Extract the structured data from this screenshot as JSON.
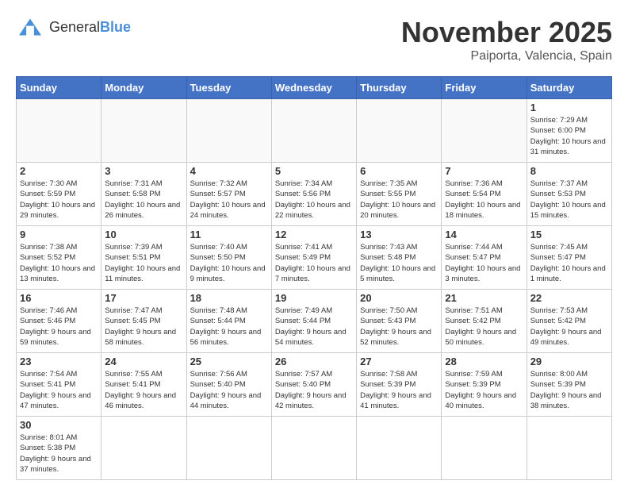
{
  "logo": {
    "text_general": "General",
    "text_blue": "Blue"
  },
  "calendar": {
    "title": "November 2025",
    "subtitle": "Paiporta, Valencia, Spain",
    "days_of_week": [
      "Sunday",
      "Monday",
      "Tuesday",
      "Wednesday",
      "Thursday",
      "Friday",
      "Saturday"
    ],
    "weeks": [
      [
        {
          "day": "",
          "info": ""
        },
        {
          "day": "",
          "info": ""
        },
        {
          "day": "",
          "info": ""
        },
        {
          "day": "",
          "info": ""
        },
        {
          "day": "",
          "info": ""
        },
        {
          "day": "",
          "info": ""
        },
        {
          "day": "1",
          "info": "Sunrise: 7:29 AM\nSunset: 6:00 PM\nDaylight: 10 hours and 31 minutes."
        }
      ],
      [
        {
          "day": "2",
          "info": "Sunrise: 7:30 AM\nSunset: 5:59 PM\nDaylight: 10 hours and 29 minutes."
        },
        {
          "day": "3",
          "info": "Sunrise: 7:31 AM\nSunset: 5:58 PM\nDaylight: 10 hours and 26 minutes."
        },
        {
          "day": "4",
          "info": "Sunrise: 7:32 AM\nSunset: 5:57 PM\nDaylight: 10 hours and 24 minutes."
        },
        {
          "day": "5",
          "info": "Sunrise: 7:34 AM\nSunset: 5:56 PM\nDaylight: 10 hours and 22 minutes."
        },
        {
          "day": "6",
          "info": "Sunrise: 7:35 AM\nSunset: 5:55 PM\nDaylight: 10 hours and 20 minutes."
        },
        {
          "day": "7",
          "info": "Sunrise: 7:36 AM\nSunset: 5:54 PM\nDaylight: 10 hours and 18 minutes."
        },
        {
          "day": "8",
          "info": "Sunrise: 7:37 AM\nSunset: 5:53 PM\nDaylight: 10 hours and 15 minutes."
        }
      ],
      [
        {
          "day": "9",
          "info": "Sunrise: 7:38 AM\nSunset: 5:52 PM\nDaylight: 10 hours and 13 minutes."
        },
        {
          "day": "10",
          "info": "Sunrise: 7:39 AM\nSunset: 5:51 PM\nDaylight: 10 hours and 11 minutes."
        },
        {
          "day": "11",
          "info": "Sunrise: 7:40 AM\nSunset: 5:50 PM\nDaylight: 10 hours and 9 minutes."
        },
        {
          "day": "12",
          "info": "Sunrise: 7:41 AM\nSunset: 5:49 PM\nDaylight: 10 hours and 7 minutes."
        },
        {
          "day": "13",
          "info": "Sunrise: 7:43 AM\nSunset: 5:48 PM\nDaylight: 10 hours and 5 minutes."
        },
        {
          "day": "14",
          "info": "Sunrise: 7:44 AM\nSunset: 5:47 PM\nDaylight: 10 hours and 3 minutes."
        },
        {
          "day": "15",
          "info": "Sunrise: 7:45 AM\nSunset: 5:47 PM\nDaylight: 10 hours and 1 minute."
        }
      ],
      [
        {
          "day": "16",
          "info": "Sunrise: 7:46 AM\nSunset: 5:46 PM\nDaylight: 9 hours and 59 minutes."
        },
        {
          "day": "17",
          "info": "Sunrise: 7:47 AM\nSunset: 5:45 PM\nDaylight: 9 hours and 58 minutes."
        },
        {
          "day": "18",
          "info": "Sunrise: 7:48 AM\nSunset: 5:44 PM\nDaylight: 9 hours and 56 minutes."
        },
        {
          "day": "19",
          "info": "Sunrise: 7:49 AM\nSunset: 5:44 PM\nDaylight: 9 hours and 54 minutes."
        },
        {
          "day": "20",
          "info": "Sunrise: 7:50 AM\nSunset: 5:43 PM\nDaylight: 9 hours and 52 minutes."
        },
        {
          "day": "21",
          "info": "Sunrise: 7:51 AM\nSunset: 5:42 PM\nDaylight: 9 hours and 50 minutes."
        },
        {
          "day": "22",
          "info": "Sunrise: 7:53 AM\nSunset: 5:42 PM\nDaylight: 9 hours and 49 minutes."
        }
      ],
      [
        {
          "day": "23",
          "info": "Sunrise: 7:54 AM\nSunset: 5:41 PM\nDaylight: 9 hours and 47 minutes."
        },
        {
          "day": "24",
          "info": "Sunrise: 7:55 AM\nSunset: 5:41 PM\nDaylight: 9 hours and 46 minutes."
        },
        {
          "day": "25",
          "info": "Sunrise: 7:56 AM\nSunset: 5:40 PM\nDaylight: 9 hours and 44 minutes."
        },
        {
          "day": "26",
          "info": "Sunrise: 7:57 AM\nSunset: 5:40 PM\nDaylight: 9 hours and 42 minutes."
        },
        {
          "day": "27",
          "info": "Sunrise: 7:58 AM\nSunset: 5:39 PM\nDaylight: 9 hours and 41 minutes."
        },
        {
          "day": "28",
          "info": "Sunrise: 7:59 AM\nSunset: 5:39 PM\nDaylight: 9 hours and 40 minutes."
        },
        {
          "day": "29",
          "info": "Sunrise: 8:00 AM\nSunset: 5:39 PM\nDaylight: 9 hours and 38 minutes."
        }
      ],
      [
        {
          "day": "30",
          "info": "Sunrise: 8:01 AM\nSunset: 5:38 PM\nDaylight: 9 hours and 37 minutes."
        },
        {
          "day": "",
          "info": ""
        },
        {
          "day": "",
          "info": ""
        },
        {
          "day": "",
          "info": ""
        },
        {
          "day": "",
          "info": ""
        },
        {
          "day": "",
          "info": ""
        },
        {
          "day": "",
          "info": ""
        }
      ]
    ]
  }
}
